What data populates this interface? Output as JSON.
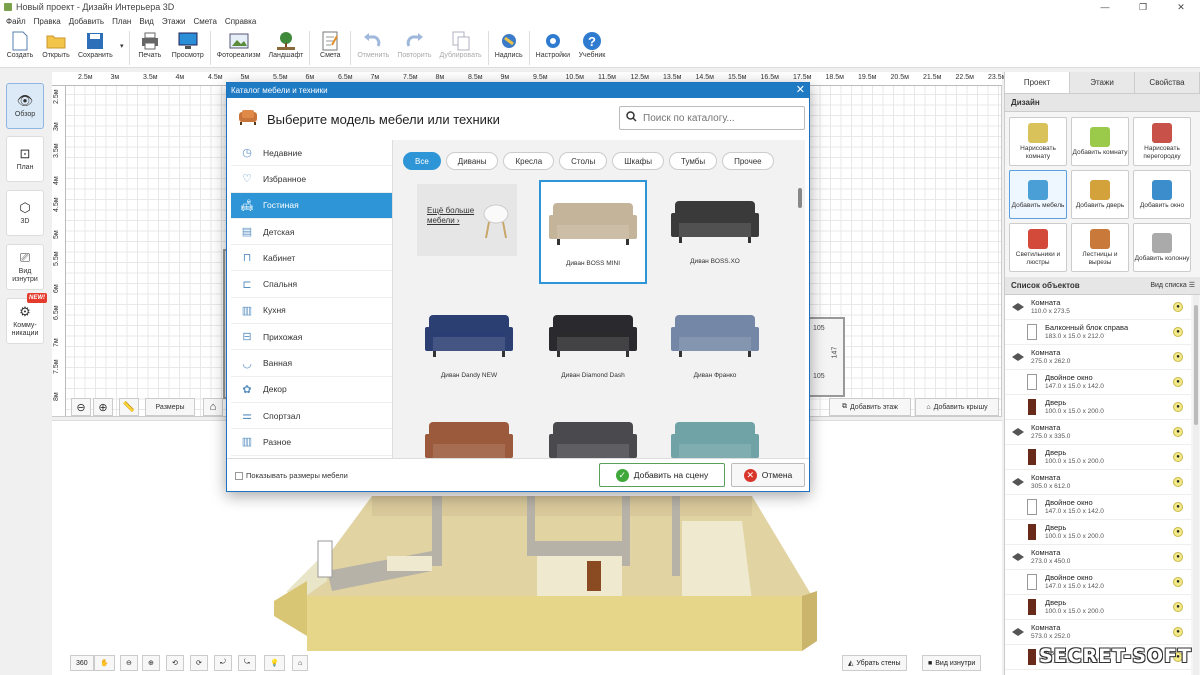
{
  "window": {
    "title": "Новый проект - Дизайн Интерьера 3D",
    "controls": [
      "—",
      "❐",
      "✕"
    ]
  },
  "menu": [
    "Файл",
    "Правка",
    "Добавить",
    "План",
    "Вид",
    "Этажи",
    "Смета",
    "Справка"
  ],
  "toolbar": [
    {
      "label": "Создать",
      "icon": "new-doc-icon",
      "enabled": true
    },
    {
      "label": "Открыть",
      "icon": "folder-open-icon",
      "enabled": true
    },
    {
      "label": "Сохранить",
      "icon": "floppy-save-icon",
      "enabled": true
    },
    {
      "label": "Печать",
      "icon": "printer-icon",
      "enabled": true
    },
    {
      "label": "Просмотр",
      "icon": "monitor-preview-icon",
      "enabled": true
    },
    {
      "label": "Фотореализм",
      "icon": "photo-render-icon",
      "enabled": true
    },
    {
      "label": "Ландшафт",
      "icon": "tree-landscape-icon",
      "enabled": true
    },
    {
      "label": "Смета",
      "icon": "estimate-icon",
      "enabled": true
    },
    {
      "label": "Отменить",
      "icon": "undo-icon",
      "enabled": false
    },
    {
      "label": "Повторить",
      "icon": "redo-icon",
      "enabled": false
    },
    {
      "label": "Дублировать",
      "icon": "duplicate-icon",
      "enabled": false
    },
    {
      "label": "Надпись",
      "icon": "text-label-icon",
      "enabled": true
    },
    {
      "label": "Настройки",
      "icon": "gear-settings-icon",
      "enabled": true
    },
    {
      "label": "Учебник",
      "icon": "help-book-icon",
      "enabled": true
    }
  ],
  "leftpanel": [
    {
      "label": "Обзор",
      "icon": "eye-icon",
      "active": true
    },
    {
      "label": "План",
      "icon": "plan-icon",
      "active": false
    },
    {
      "label": "3D",
      "icon": "cube-3d-icon",
      "active": false
    },
    {
      "label": "Вид изнутри",
      "icon": "inside-view-icon",
      "active": false
    },
    {
      "label": "Комму-\nникации",
      "icon": "pipes-icon",
      "active": false,
      "badge": "NEW!"
    }
  ],
  "ruler": {
    "top": [
      "2.5м",
      "3м",
      "3.5м",
      "4м",
      "4.5м",
      "5м",
      "5.5м",
      "6м",
      "6.5м",
      "7м",
      "7.5м",
      "8м",
      "8.5м",
      "9м",
      "9.5м",
      "10.5м",
      "11.5м",
      "12.5м",
      "13.5м",
      "14.5м",
      "15.5м",
      "16.5м",
      "17.5м",
      "18.5м",
      "19.5м",
      "20.5м",
      "21.5м",
      "22.5м",
      "23.5м"
    ],
    "left": [
      "2.5м",
      "3м",
      "3.5м",
      "4м",
      "4.5м",
      "5м",
      "5.5м",
      "6м",
      "6.5м",
      "7м",
      "7.5м",
      "8м"
    ]
  },
  "plan": {
    "dim_labels": [
      "105",
      "147",
      "105"
    ],
    "controls": {
      "zoom_out": "⊖",
      "zoom_in": "⊕",
      "measure": "Размеры",
      "home": "⌂",
      "add_floor": "Добавить этаж",
      "add_roof": "Добавить крышу"
    }
  },
  "view3d": {
    "controls": [
      "360",
      "✋",
      "⊖",
      "⊕",
      "⟲",
      "⟳",
      "⤾",
      "⤿",
      "💡",
      "⌂"
    ],
    "hide_walls": "Убрать стены",
    "inside_view": "Вид изнутри",
    "watermark": "SECRET-SOFT"
  },
  "rightpanel": {
    "tabs": [
      "Проект",
      "Этажи",
      "Свойства"
    ],
    "design_title": "Дизайн",
    "design_buttons": [
      {
        "label": "Нарисовать комнату",
        "icon": "draw-room-icon",
        "color": "#d9c25a"
      },
      {
        "label": "Добавить комнату",
        "icon": "add-room-icon",
        "color": "#9bc94a"
      },
      {
        "label": "Нарисовать перегородку",
        "icon": "brick-wall-icon",
        "color": "#c8514a"
      },
      {
        "label": "Добавить мебель",
        "icon": "armchair-icon",
        "color": "#4aa0d6",
        "active": true
      },
      {
        "label": "Добавить дверь",
        "icon": "door-icon",
        "color": "#d4a23a"
      },
      {
        "label": "Добавить окно",
        "icon": "window-icon",
        "color": "#3b8ecb"
      },
      {
        "label": "Светильники и люстры",
        "icon": "lamp-icon",
        "color": "#d44a3a"
      },
      {
        "label": "Лестницы и вырезы",
        "icon": "stairs-icon",
        "color": "#c97a3a"
      },
      {
        "label": "Добавить колонну",
        "icon": "column-icon",
        "color": "#aaa"
      }
    ],
    "objects_title": "Список объектов",
    "objects_view": "Вид списка",
    "objects": [
      {
        "name": "Комната",
        "size": "110.0 x 273.5",
        "type": "room",
        "child": false
      },
      {
        "name": "Балконный блок справа",
        "size": "183.0 x 15.0 x 212.0",
        "type": "window",
        "child": true
      },
      {
        "name": "Комната",
        "size": "275.0 x 262.0",
        "type": "room",
        "child": false
      },
      {
        "name": "Двойное окно",
        "size": "147.0 x 15.0 x 142.0",
        "type": "window",
        "child": true
      },
      {
        "name": "Дверь",
        "size": "100.0 x 15.0 x 200.0",
        "type": "door",
        "child": true
      },
      {
        "name": "Комната",
        "size": "275.0 x 335.0",
        "type": "room",
        "child": false
      },
      {
        "name": "Дверь",
        "size": "100.0 x 15.0 x 200.0",
        "type": "door",
        "child": true
      },
      {
        "name": "Комната",
        "size": "305.0 x 612.0",
        "type": "room",
        "child": false
      },
      {
        "name": "Двойное окно",
        "size": "147.0 x 15.0 x 142.0",
        "type": "window",
        "child": true
      },
      {
        "name": "Дверь",
        "size": "100.0 x 15.0 x 200.0",
        "type": "door",
        "child": true
      },
      {
        "name": "Комната",
        "size": "273.0 x 450.0",
        "type": "room",
        "child": false
      },
      {
        "name": "Двойное окно",
        "size": "147.0 x 15.0 x 142.0",
        "type": "window",
        "child": true
      },
      {
        "name": "Дверь",
        "size": "100.0 x 15.0 x 200.0",
        "type": "door",
        "child": true
      },
      {
        "name": "Комната",
        "size": "573.0 x 252.0",
        "type": "room",
        "child": false
      },
      {
        "name": "Дверь",
        "size": "80.0 x 15.0 x 200.0",
        "type": "door",
        "child": true
      }
    ]
  },
  "dialog": {
    "title": "Каталог мебели и техники",
    "heading": "Выберите модель мебели или техники",
    "search_placeholder": "Поиск по каталогу...",
    "categories": [
      {
        "label": "Недавние",
        "icon": "clock-icon"
      },
      {
        "label": "Избранное",
        "icon": "heart-icon"
      },
      {
        "label": "Гостиная",
        "icon": "sofa-icon",
        "active": true
      },
      {
        "label": "Детская",
        "icon": "crib-icon"
      },
      {
        "label": "Кабинет",
        "icon": "desk-icon"
      },
      {
        "label": "Спальня",
        "icon": "bed-icon"
      },
      {
        "label": "Кухня",
        "icon": "kitchen-icon"
      },
      {
        "label": "Прихожая",
        "icon": "hallway-icon"
      },
      {
        "label": "Ванная",
        "icon": "bathtub-icon"
      },
      {
        "label": "Декор",
        "icon": "plant-decor-icon"
      },
      {
        "label": "Спортзал",
        "icon": "dumbbell-icon"
      },
      {
        "label": "Разное",
        "icon": "misc-icon"
      }
    ],
    "filters": [
      {
        "label": "Все",
        "active": true
      },
      {
        "label": "Диваны"
      },
      {
        "label": "Кресла"
      },
      {
        "label": "Столы"
      },
      {
        "label": "Шкафы"
      },
      {
        "label": "Тумбы"
      },
      {
        "label": "Прочее"
      }
    ],
    "promo_card": "Ещё больше мебели ›",
    "items": [
      {
        "name": "Диван BOSS MINI",
        "color": "#c4b49a",
        "selected": true
      },
      {
        "name": "Диван BOSS.XO",
        "color": "#3a3a3a"
      },
      {
        "name": "Диван Dandy NEW",
        "color": "#2b3f73"
      },
      {
        "name": "Диван Diamond Dash",
        "color": "#2a2a2e"
      },
      {
        "name": "Диван Франко",
        "color": "#7487a6"
      },
      {
        "name": "",
        "color": "#9c5a3c"
      },
      {
        "name": "",
        "color": "#4a4a4e"
      },
      {
        "name": "",
        "color": "#6fa3a6"
      }
    ],
    "show_sizes": "Показывать размеры мебели",
    "add_button": "Добавить на сцену",
    "cancel_button": "Отмена"
  }
}
